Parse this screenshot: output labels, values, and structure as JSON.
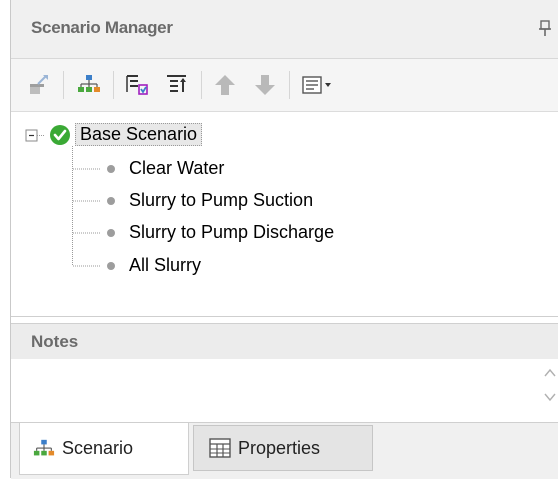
{
  "window": {
    "title": "Scenario Manager"
  },
  "toolbar": {
    "buttons": [
      {
        "icon": "clone-scenario-icon"
      },
      {
        "icon": "scenario-tree-icon"
      },
      {
        "icon": "add-child-scenario-icon"
      },
      {
        "icon": "add-sibling-scenario-icon"
      },
      {
        "icon": "move-up-arrow-icon"
      },
      {
        "icon": "move-down-arrow-icon"
      },
      {
        "icon": "list-view-dropdown-icon"
      }
    ]
  },
  "tree": {
    "root": {
      "label": "Base Scenario",
      "status": "active",
      "status_color": "#3aa935"
    },
    "children": [
      {
        "label": "Clear Water"
      },
      {
        "label": "Slurry to Pump Suction"
      },
      {
        "label": "Slurry to Pump Discharge"
      },
      {
        "label": "All Slurry"
      }
    ]
  },
  "notes": {
    "label": "Notes",
    "value": ""
  },
  "tabs": [
    {
      "label": "Scenario",
      "icon": "scenario-tree-icon",
      "active": true
    },
    {
      "label": "Properties",
      "icon": "properties-grid-icon",
      "active": false
    }
  ]
}
